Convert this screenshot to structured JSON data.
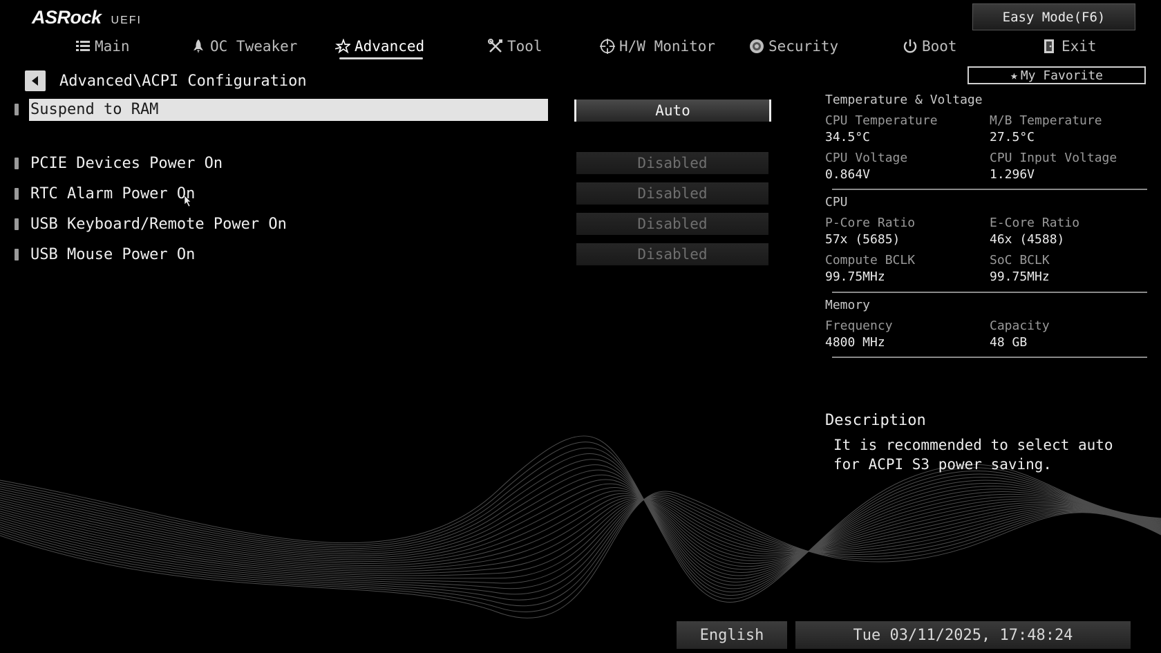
{
  "header": {
    "brand": "ASRock",
    "sub": "UEFI",
    "easy_mode_label": "Easy Mode(F6)",
    "favorite_label": "My Favorite"
  },
  "nav": {
    "tabs": [
      {
        "label": "Main",
        "icon": "list-icon"
      },
      {
        "label": "OC Tweaker",
        "icon": "rocket-icon"
      },
      {
        "label": "Advanced",
        "icon": "star-icon",
        "active": true
      },
      {
        "label": "Tool",
        "icon": "tools-icon"
      },
      {
        "label": "H/W Monitor",
        "icon": "crosshair-icon"
      },
      {
        "label": "Security",
        "icon": "shield-icon"
      },
      {
        "label": "Boot",
        "icon": "power-icon"
      },
      {
        "label": "Exit",
        "icon": "exit-door-icon"
      }
    ]
  },
  "breadcrumb": "Advanced\\ACPI Configuration",
  "settings": [
    {
      "label": "Suspend to RAM",
      "value": "Auto",
      "selected": true
    },
    {
      "label": "PCIE Devices Power On",
      "value": "Disabled"
    },
    {
      "label": "RTC Alarm Power On",
      "value": "Disabled"
    },
    {
      "label": "USB Keyboard/Remote Power On",
      "value": "Disabled"
    },
    {
      "label": "USB Mouse Power On",
      "value": "Disabled"
    }
  ],
  "hw": {
    "temp_voltage": {
      "title": "Temperature & Voltage",
      "cpu_temp_label": "CPU Temperature",
      "cpu_temp": "34.5°C",
      "mb_temp_label": "M/B Temperature",
      "mb_temp": "27.5°C",
      "cpu_volt_label": "CPU Voltage",
      "cpu_volt": "0.864V",
      "cpu_in_volt_label": "CPU Input Voltage",
      "cpu_in_volt": "1.296V"
    },
    "cpu": {
      "title": "CPU",
      "pcore_label": "P-Core Ratio",
      "pcore": "57x (5685)",
      "ecore_label": "E-Core Ratio",
      "ecore": "46x (4588)",
      "bclk_label": "Compute BCLK",
      "bclk": "99.75MHz",
      "soc_label": "SoC BCLK",
      "soc": "99.75MHz"
    },
    "memory": {
      "title": "Memory",
      "freq_label": "Frequency",
      "freq": "4800 MHz",
      "cap_label": "Capacity",
      "cap": "48 GB"
    }
  },
  "description": {
    "title": "Description",
    "text": "It is recommended to select auto for ACPI S3 power saving."
  },
  "footer": {
    "language": "English",
    "datetime": "Tue 03/11/2025, 17:48:24"
  }
}
